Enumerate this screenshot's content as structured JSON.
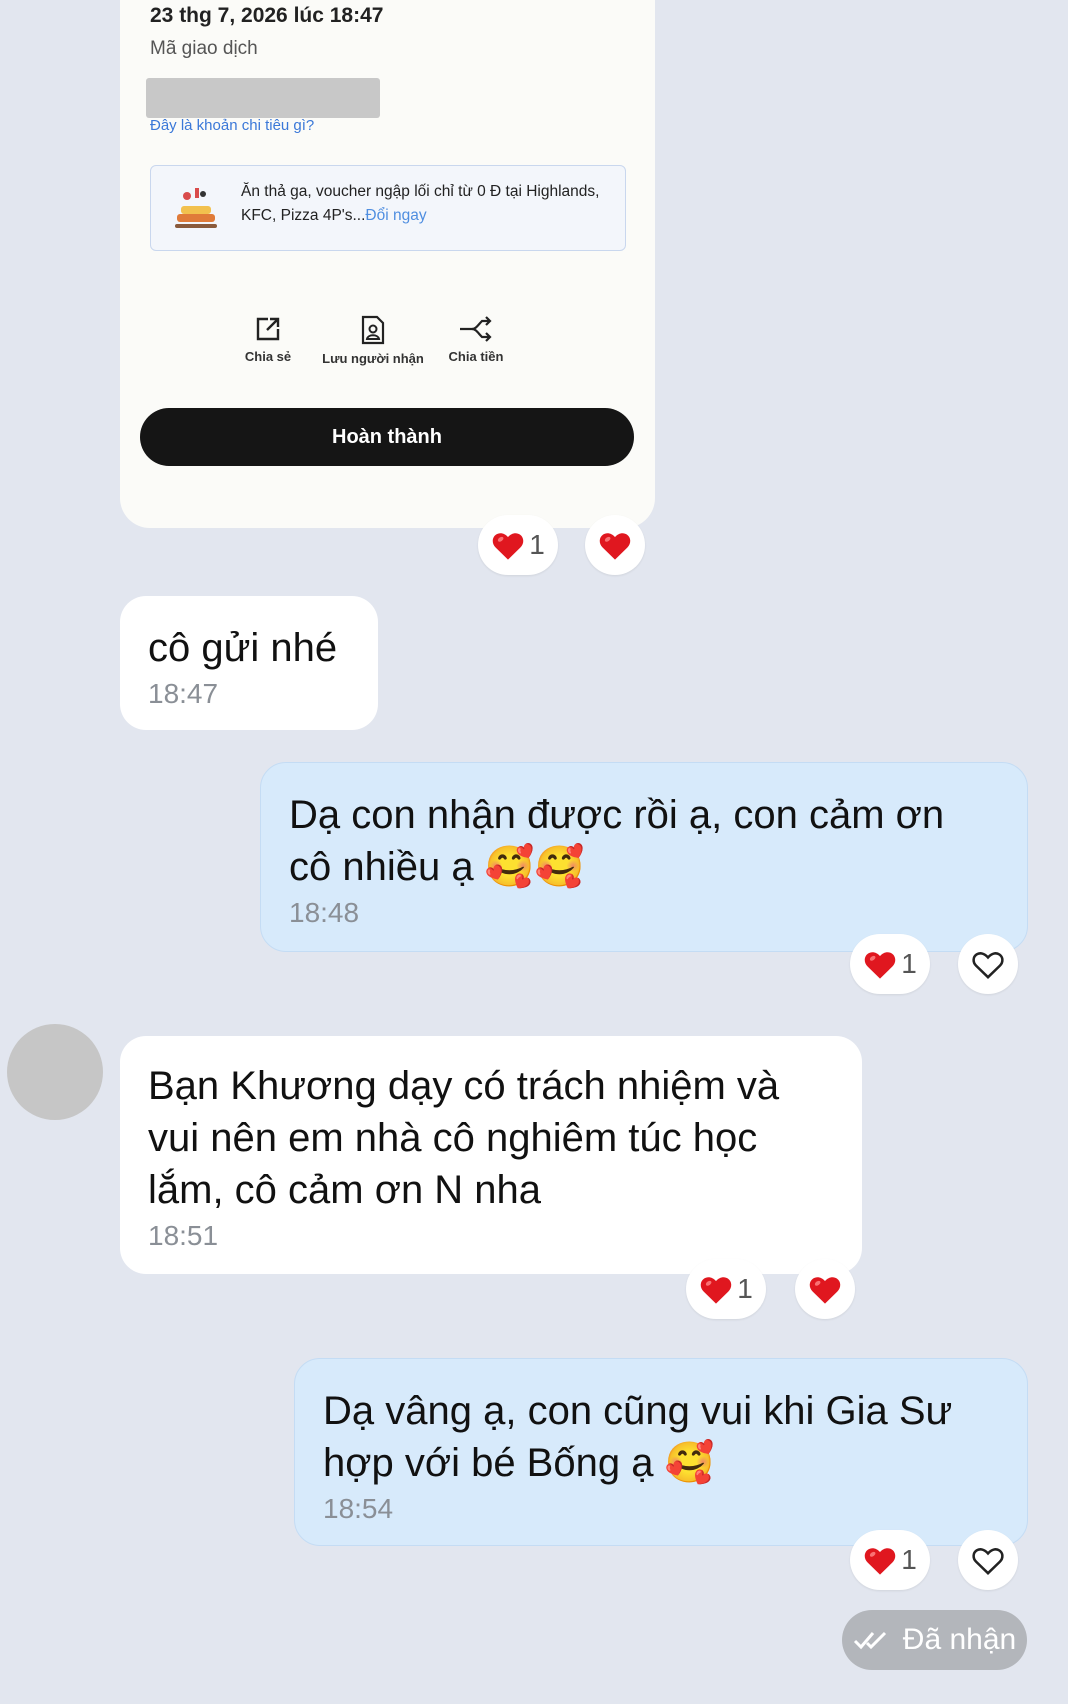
{
  "receipt": {
    "date": "23 thg 7, 2026 lúc 18:47",
    "transaction_label": "Mã giao dịch",
    "category_link": "Đây là khoản chi tiêu gì?",
    "voucher_text": "Ăn thả ga, voucher ngập lối chỉ từ 0 Đ tại Highlands, KFC, Pizza 4P's...",
    "voucher_link": "Đổi ngay",
    "actions": [
      {
        "label": "Chia sẻ",
        "icon": "share-icon"
      },
      {
        "label": "Lưu người nhận",
        "icon": "save-contact-icon"
      },
      {
        "label": "Chia tiền",
        "icon": "split-money-icon"
      }
    ],
    "done_button": "Hoàn thành",
    "reaction_count": "1"
  },
  "messages": [
    {
      "direction": "incoming",
      "text": "cô gửi nhé",
      "time": "18:47"
    },
    {
      "direction": "outgoing",
      "text_line1": "Dạ con nhận được rồi ạ, con cảm ơn",
      "text_line2": "cô nhiều ạ 🥰🥰",
      "time": "18:48",
      "reaction_count": "1"
    },
    {
      "direction": "incoming",
      "text_line1": "Bạn Khương dạy có trách nhiệm và",
      "text_line2": "vui nên em nhà cô nghiêm túc học",
      "text_line3": "lắm, cô cảm ơn N nha",
      "time": "18:51",
      "reaction_count": "1"
    },
    {
      "direction": "outgoing",
      "text_line1": "Dạ vâng ạ, con cũng vui khi Gia Sư",
      "text_line2": "hợp với bé Bống ạ 🥰",
      "time": "18:54",
      "reaction_count": "1"
    }
  ],
  "status": {
    "label": "Đã nhận",
    "icon": "double-check-icon"
  },
  "colors": {
    "heart": "#e0171f",
    "background": "#e2e6ef",
    "outgoing_bubble": "#d7eafb",
    "incoming_bubble": "#ffffff"
  }
}
